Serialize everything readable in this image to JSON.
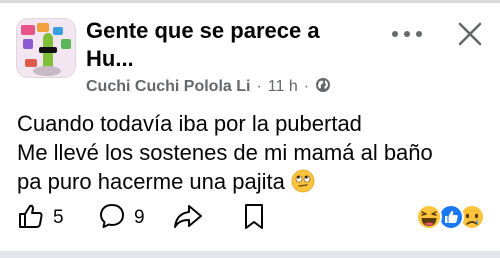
{
  "post": {
    "group_name_line1": "Gente que se parece a",
    "group_name_line2": "Hu...",
    "author": "Cuchi Cuchi Polola Li",
    "separator": "·",
    "timestamp": "11 h",
    "visibility_icon": "globe-icon",
    "body": {
      "line1": "Cuando todavía iba por la pubertad",
      "line2": "Me llevé los sostenes de mi mamá al baño",
      "line3": "pa puro hacerme una pajita",
      "emoji": "rolling-eyes-face-emoji"
    }
  },
  "actions": {
    "like": {
      "icon": "thumbs-up-icon",
      "count": "5"
    },
    "comment": {
      "icon": "comment-bubble-icon",
      "count": "9"
    },
    "share": {
      "icon": "share-arrow-icon"
    },
    "save": {
      "icon": "bookmark-icon"
    }
  },
  "header_controls": {
    "more": "more-options-icon",
    "close": "close-icon"
  },
  "reactions": [
    "haha-reaction",
    "like-reaction",
    "sad-reaction"
  ],
  "colors": {
    "text": "#050505",
    "secondary_text": "#65676b",
    "like_blue": "#1877f2",
    "emoji_yellow": "#fcc43c"
  }
}
